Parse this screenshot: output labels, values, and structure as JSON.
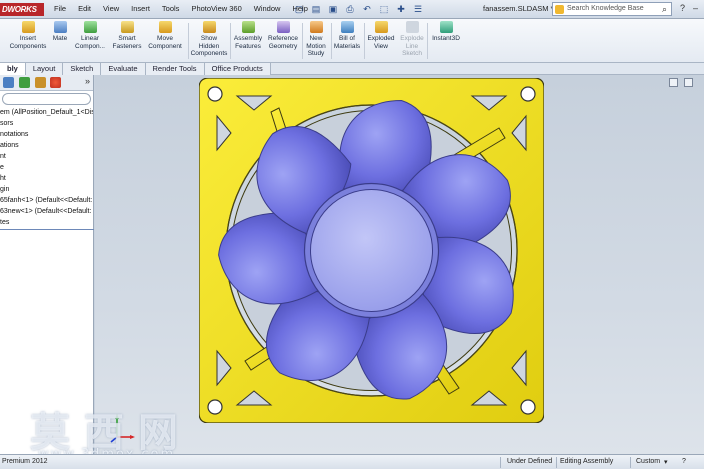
{
  "app": {
    "logo_text": "DWORKS",
    "doc_title": "fanassem.SLDASM *"
  },
  "menu": [
    "File",
    "Edit",
    "View",
    "Insert",
    "Tools",
    "PhotoView 360",
    "Window",
    "Help"
  ],
  "search": {
    "placeholder": "Search Knowledge Base"
  },
  "ribbon": {
    "insert_components": "Insert Components",
    "mate": "Mate",
    "linear_component": "Linear Compon...",
    "smart_fasteners": "Smart Fasteners",
    "move_component": "Move Component",
    "show_hidden": "Show Hidden Components",
    "assembly_features": "Assembly Features",
    "reference_geometry": "Reference Geometry",
    "new_motion_study": "New Motion Study",
    "bill_of_materials": "Bill of Materials",
    "exploded_view": "Exploded View",
    "explode_line_sketch": "Explode Line Sketch",
    "instant3d": "Instant3D"
  },
  "tabs": [
    "bly",
    "Layout",
    "Sketch",
    "Evaluate",
    "Render Tools",
    "Office Products"
  ],
  "tree": [
    "em  (AllPosition_Default_1<Disp",
    "sors",
    "notations",
    "ations",
    "nt",
    "e",
    "ht",
    "gin",
    "65fanh<1> (Default<<Default:",
    "63new<1> (Default<<Default:",
    "tes"
  ],
  "status": {
    "left": "Premium 2012",
    "under_defined": "Under Defined",
    "mode": "Editing Assembly",
    "units": "Custom"
  },
  "watermark": {
    "cn": "莫西网",
    "url": "www.3dmox.com"
  },
  "colors": {
    "frame_yellow": "#f2e11a",
    "blade_blue": "#6d6fe0",
    "hub_blue": "#a9aef2",
    "viewport_bg": "#c9d3df"
  }
}
